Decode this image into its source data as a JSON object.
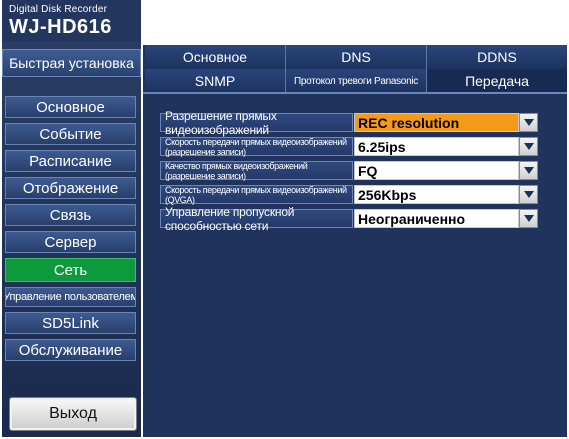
{
  "app": {
    "subtitle": "Digital Disk Recorder",
    "model": "WJ-HD616"
  },
  "quick_setup": "Быстрая установка",
  "sidebar": {
    "items": [
      {
        "label": "Основное"
      },
      {
        "label": "Событие"
      },
      {
        "label": "Расписание"
      },
      {
        "label": "Отображение"
      },
      {
        "label": "Связь"
      },
      {
        "label": "Сервер"
      },
      {
        "label": "Сеть",
        "active": true
      },
      {
        "label": "Управление пользователем"
      },
      {
        "label": "SD5Link"
      },
      {
        "label": "Обслуживание"
      }
    ],
    "exit_label": "Выход"
  },
  "tabs": {
    "row1": [
      {
        "label": "Основное"
      },
      {
        "label": "DNS"
      },
      {
        "label": "DDNS"
      }
    ],
    "row2": [
      {
        "label": "SNMP"
      },
      {
        "label": "Протокол тревоги Panasonic"
      },
      {
        "label": "Передача",
        "active": true
      }
    ]
  },
  "settings": [
    {
      "label": "Разрешение прямых видеоизображений",
      "value": "REC resolution",
      "highlight": true
    },
    {
      "label": "Скорость передачи прямых видеоизображений (разрешение записи)",
      "value": "6.25ips"
    },
    {
      "label": "Качество прямых видеоизображений (разрешение записи)",
      "value": "FQ"
    },
    {
      "label": "Скорость передачи прямых видеоизображений (QVGA)",
      "value": "256Kbps"
    },
    {
      "label": "Управление пропускной способностью сети",
      "value": "Неограниченно"
    }
  ],
  "colors": {
    "panel": "#1f335d",
    "active_green": "#0d9a3c",
    "highlight_orange": "#f59a17"
  }
}
